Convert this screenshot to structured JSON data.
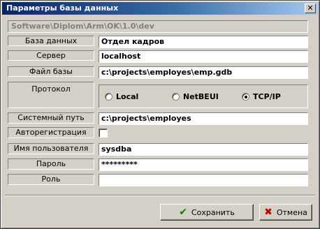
{
  "window": {
    "title": "Параметры базы данных",
    "close_glyph": "✕"
  },
  "path": "Software\\Diplom\\Arm\\OK\\1.0\\dev",
  "fields": {
    "database": {
      "label": "База данных",
      "value": "Отдел кадров"
    },
    "server": {
      "label": "Сервер",
      "value": "localhost"
    },
    "db_file": {
      "label": "Файл базы",
      "value": "c:\\projects\\employes\\emp.gdb"
    },
    "protocol": {
      "label": "Протокол",
      "options": [
        "Local",
        "NetBEUI",
        "TCP/IP"
      ],
      "selected": "TCP/IP"
    },
    "system_path": {
      "label": "Системный путь",
      "value": "c:\\projects\\employes"
    },
    "autoregister": {
      "label": "Авторегистрация",
      "checked": false
    },
    "username": {
      "label": "Имя пользователя",
      "value": "sysdba"
    },
    "password": {
      "label": "Пароль",
      "value": "*********"
    },
    "role": {
      "label": "Роль",
      "value": ""
    }
  },
  "buttons": {
    "save": {
      "label": "Сохранить",
      "icon": "check-icon",
      "icon_color": "#008000"
    },
    "cancel": {
      "label": "Отмена",
      "icon": "x-icon",
      "icon_color": "#c00000"
    }
  }
}
